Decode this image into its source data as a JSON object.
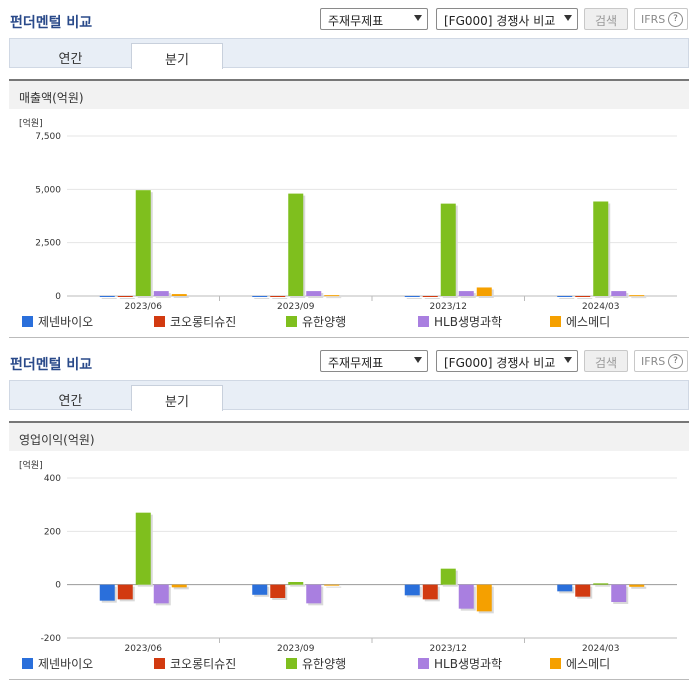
{
  "sections": [
    {
      "title": "펀더멘털 비교",
      "select_statement": "주재무제표",
      "select_compare": "[FG000] 경쟁사 비교",
      "search_label": "검색",
      "ifrs_label": "IFRS",
      "help_icon_label": "?",
      "tabs": [
        "연간",
        "분기"
      ],
      "active_tab": "분기",
      "subhead": "매출액(억원)"
    },
    {
      "title": "펀더멘털 비교",
      "select_statement": "주재무제표",
      "select_compare": "[FG000] 경쟁사 비교",
      "search_label": "검색",
      "ifrs_label": "IFRS",
      "help_icon_label": "?",
      "tabs": [
        "연간",
        "분기"
      ],
      "active_tab": "분기",
      "subhead": "영업이익(억원)"
    }
  ],
  "colors": {
    "series": [
      "#2a6fdb",
      "#d23a10",
      "#7fbf1e",
      "#a97fe0",
      "#f5a000"
    ],
    "title": "#2a4a8a"
  },
  "chart_data": [
    {
      "type": "bar",
      "unit_label": "[억원]",
      "categories": [
        "2023/06",
        "2023/09",
        "2023/12",
        "2024/03"
      ],
      "ylim": [
        0,
        7500
      ],
      "yticks": [
        0,
        2500,
        5000,
        7500
      ],
      "ytick_labels": [
        "0",
        "2,500",
        "5,000",
        "7,500"
      ],
      "grid": true,
      "legend_position": "bottom",
      "series": [
        {
          "name": "제넨바이오",
          "values": [
            2,
            2,
            2,
            2
          ]
        },
        {
          "name": "코오롱티슈진",
          "values": [
            0,
            0,
            0,
            0
          ]
        },
        {
          "name": "유한양행",
          "values": [
            4960,
            4800,
            4330,
            4430
          ]
        },
        {
          "name": "HLB생명과학",
          "values": [
            230,
            230,
            230,
            230
          ]
        },
        {
          "name": "에스메디",
          "values": [
            90,
            40,
            400,
            40
          ]
        }
      ]
    },
    {
      "type": "bar",
      "unit_label": "[억원]",
      "categories": [
        "2023/06",
        "2023/09",
        "2023/12",
        "2024/03"
      ],
      "ylim": [
        -200,
        400
      ],
      "yticks": [
        -200,
        0,
        200,
        400
      ],
      "ytick_labels": [
        "-200",
        "0",
        "200",
        "400"
      ],
      "grid": true,
      "legend_position": "bottom",
      "series": [
        {
          "name": "제넨바이오",
          "values": [
            -60,
            -38,
            -40,
            -25
          ]
        },
        {
          "name": "코오롱티슈진",
          "values": [
            -55,
            -50,
            -55,
            -45
          ]
        },
        {
          "name": "유한양행",
          "values": [
            270,
            10,
            60,
            5
          ]
        },
        {
          "name": "HLB생명과학",
          "values": [
            -70,
            -70,
            -90,
            -65
          ]
        },
        {
          "name": "에스메디",
          "values": [
            -10,
            -3,
            -100,
            -8
          ]
        }
      ]
    }
  ]
}
